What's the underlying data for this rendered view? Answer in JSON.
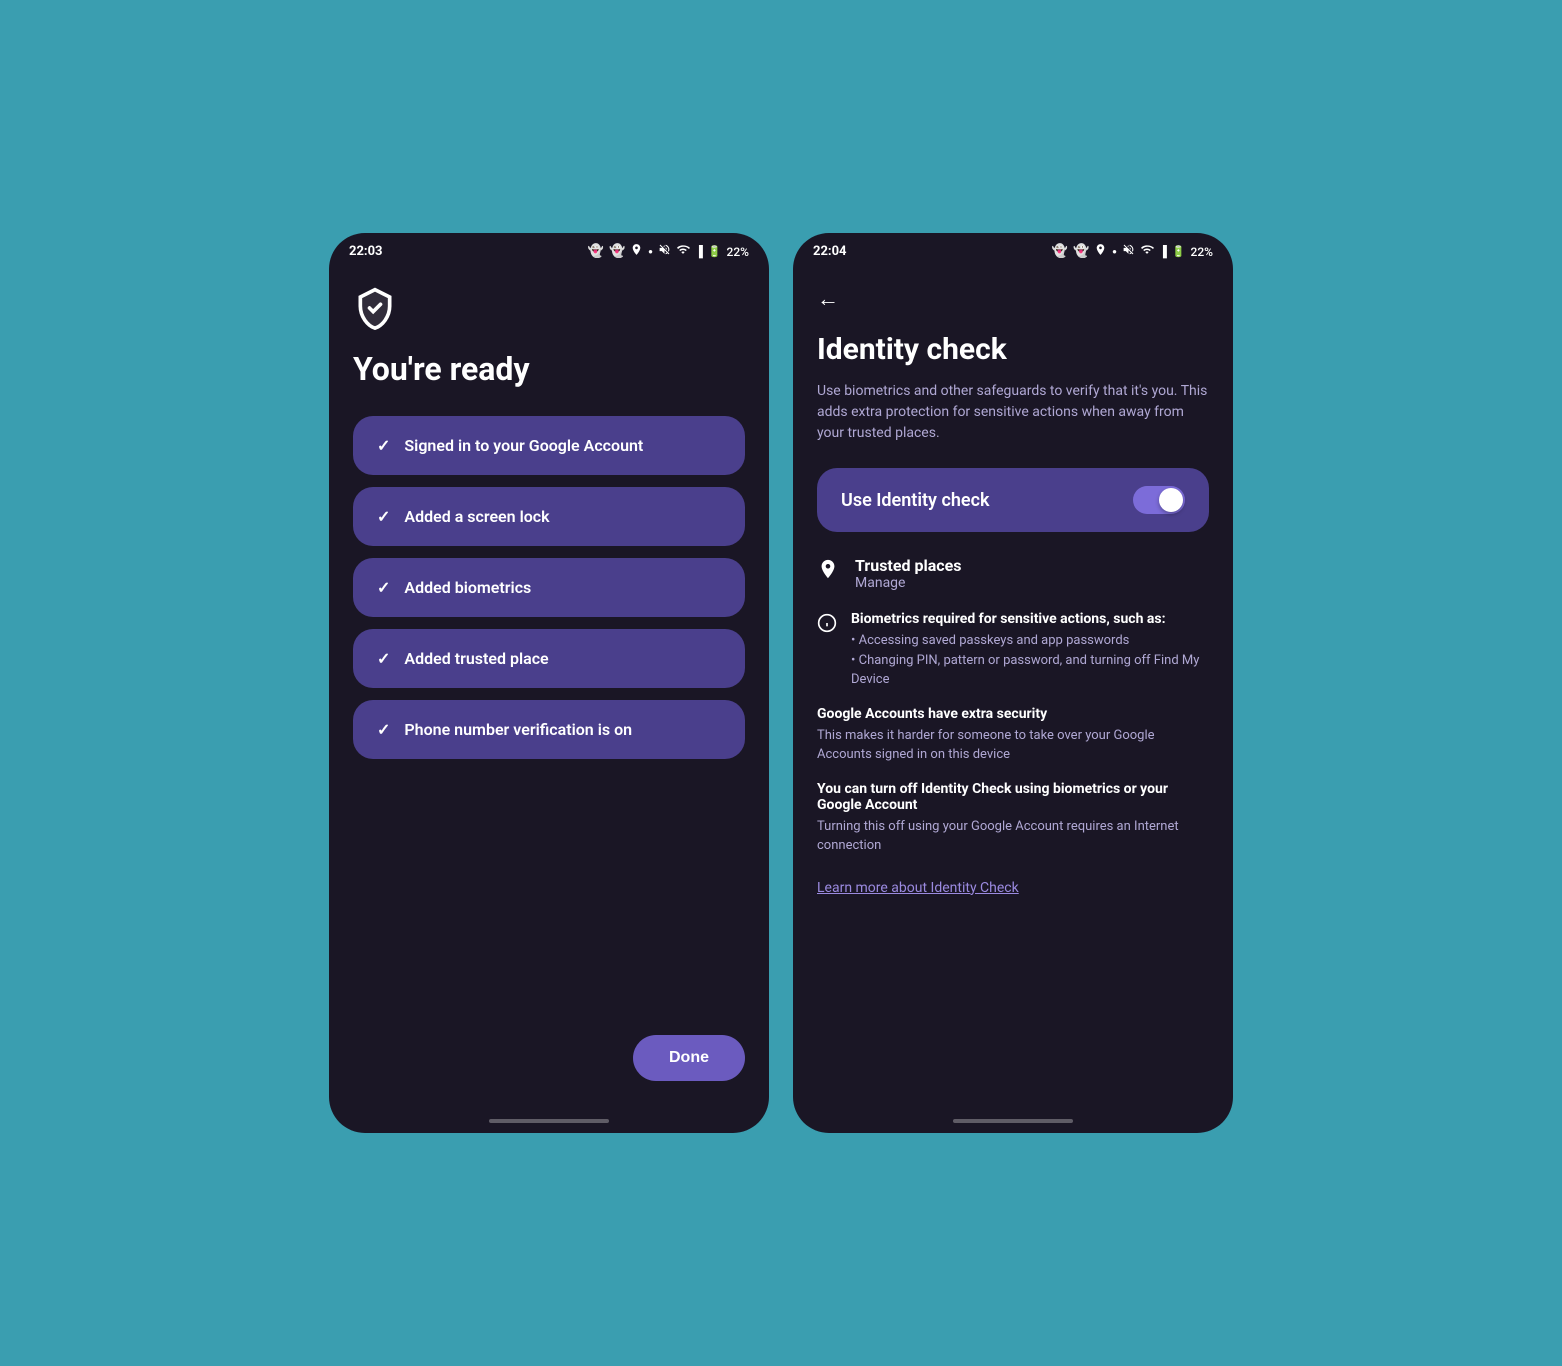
{
  "left_phone": {
    "status_bar": {
      "time": "22:03",
      "battery": "22%"
    },
    "title": "You're ready",
    "check_items": [
      {
        "label": "Signed in to your Google Account"
      },
      {
        "label": "Added a screen lock"
      },
      {
        "label": "Added biometrics"
      },
      {
        "label": "Added trusted place"
      },
      {
        "label": "Phone number verification is on"
      }
    ],
    "done_button": "Done"
  },
  "right_phone": {
    "status_bar": {
      "time": "22:04",
      "battery": "22%"
    },
    "title": "Identity check",
    "description": "Use biometrics and other safeguards to verify that it's you. This adds extra protection for sensitive actions when away from your trusted places.",
    "toggle_label": "Use Identity check",
    "toggle_on": true,
    "trusted_places": {
      "title": "Trusted places",
      "manage": "Manage"
    },
    "info_section": {
      "bold": "Biometrics required for sensitive actions, such as:",
      "points": "• Accessing saved passkeys and app passwords\n• Changing PIN, pattern or password, and turning off Find My Device"
    },
    "google_accounts_section": {
      "bold": "Google Accounts have extra security",
      "text": "This makes it harder for someone to take over your Google Accounts signed in on this device"
    },
    "turn_off_section": {
      "bold": "You can turn off Identity Check using biometrics or your Google Account",
      "text": "Turning this off using your Google Account requires an Internet connection"
    },
    "learn_more": "Learn more about Identity Check"
  }
}
